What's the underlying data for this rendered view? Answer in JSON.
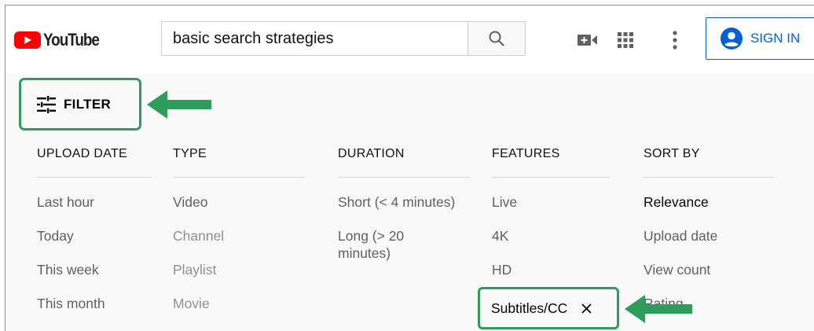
{
  "header": {
    "logo_text": "YouTube",
    "search": {
      "value": "basic search strategies"
    },
    "signin_label": "SIGN IN",
    "icons": [
      "video-camera-icon",
      "apps-grid-icon",
      "more-vertical-icon",
      "account-circle-icon",
      "search-icon"
    ]
  },
  "filter": {
    "label": "FILTER"
  },
  "columns": [
    {
      "header": "UPLOAD DATE",
      "options": [
        "Last hour",
        "Today",
        "This week",
        "This month"
      ]
    },
    {
      "header": "TYPE",
      "options": [
        "Video",
        "Channel",
        "Playlist",
        "Movie"
      ]
    },
    {
      "header": "DURATION",
      "options": [
        "Short (< 4 minutes)",
        "Long (> 20 minutes)"
      ]
    },
    {
      "header": "FEATURES",
      "options": [
        "Live",
        "4K",
        "HD",
        "Subtitles/CC"
      ]
    },
    {
      "header": "SORT BY",
      "options": [
        "Relevance",
        "Upload date",
        "View count",
        "Rating"
      ]
    }
  ],
  "colors": {
    "accent_blue": "#065fd4",
    "annotation_green": "#2e9d5b",
    "youtube_red": "#ff0000"
  }
}
